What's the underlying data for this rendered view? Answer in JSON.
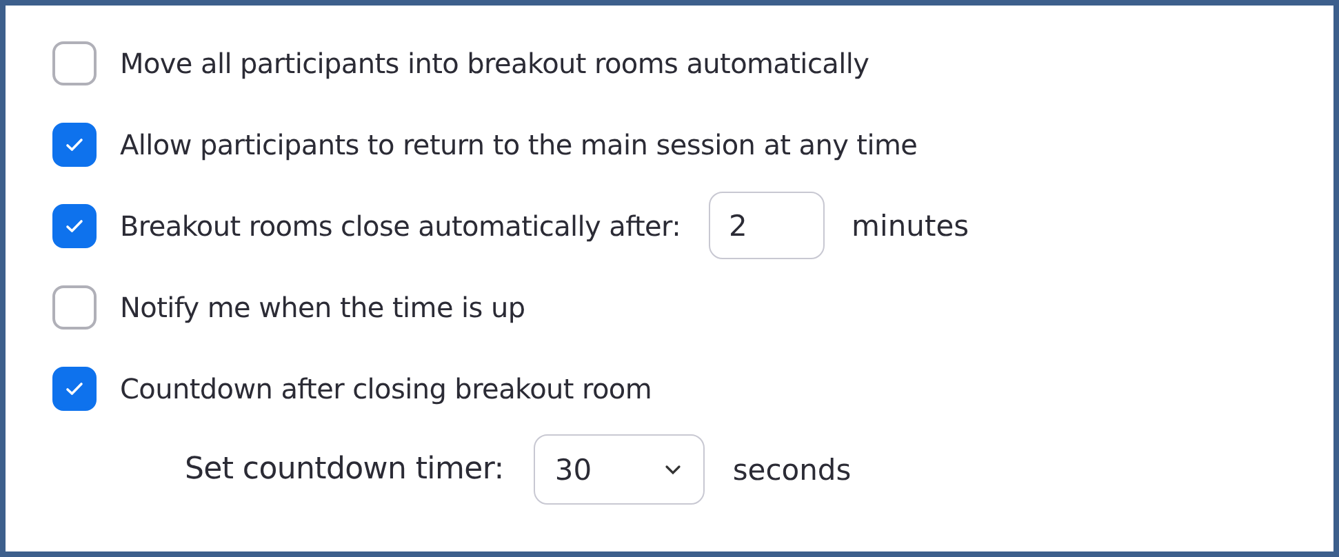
{
  "options": [
    {
      "kind": "checkbox",
      "label": "Move all participants into breakout rooms automatically",
      "checked": false
    },
    {
      "kind": "checkbox",
      "label": "Allow participants to return to the main session at any time",
      "checked": true
    },
    {
      "kind": "checkbox",
      "label": "Breakout rooms close automatically after:",
      "checked": true,
      "value": "2",
      "unit": "minutes"
    },
    {
      "kind": "checkbox",
      "label": "Notify me when the time is up",
      "checked": false
    },
    {
      "kind": "checkbox",
      "label": "Countdown after closing breakout room",
      "checked": true
    },
    {
      "kind": "select",
      "label": "Set countdown timer:",
      "value": "30",
      "unit": "seconds"
    }
  ]
}
